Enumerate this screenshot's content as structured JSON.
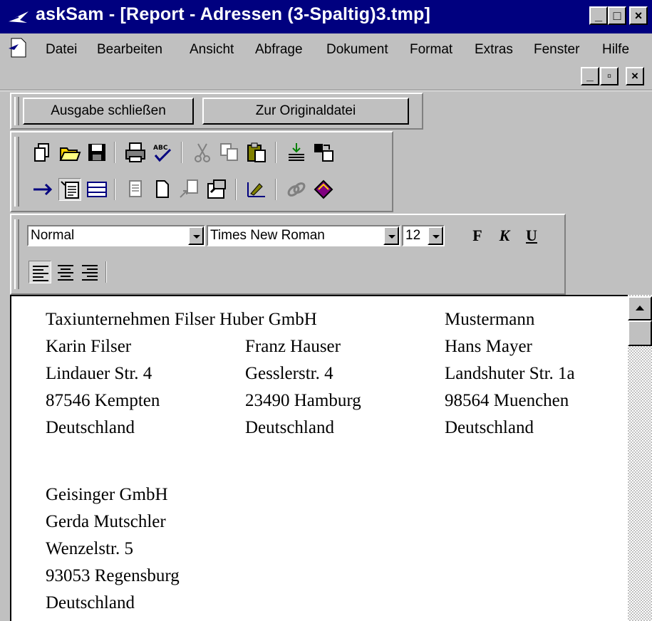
{
  "window": {
    "title": "askSam - [Report - Adressen (3-Spaltig)3.tmp]",
    "minimize_label": "_",
    "maximize_label": "□",
    "close_label": "×",
    "mdi_minimize_label": "_",
    "mdi_restore_label": "▫",
    "mdi_close_label": "×"
  },
  "menu": {
    "items": [
      "Datei",
      "Bearbeiten",
      "Ansicht",
      "Abfrage",
      "Dokument",
      "Format",
      "Extras",
      "Fenster",
      "Hilfe"
    ]
  },
  "report_toolbar": {
    "close_output": "Ausgabe schließen",
    "to_original": "Zur Originaldatei"
  },
  "format_toolbar": {
    "style_value": "Normal",
    "font_value": "Times New Roman",
    "size_value": "12",
    "bold_label": "F",
    "italic_label": "K",
    "underline_label": "U"
  },
  "document": {
    "columns": [
      [
        "Taxiunternehmen Filser Huber GmbH",
        "Karin Filser",
        "Lindauer Str. 4",
        "87546 Kempten",
        "Deutschland"
      ],
      [
        "Franz Hauser",
        "Gesslerstr. 4",
        "23490 Hamburg",
        "Deutschland"
      ],
      [
        "Mustermann",
        "Hans Mayer",
        "Landshuter Str. 1a",
        "98564 Muenchen",
        "Deutschland"
      ]
    ],
    "second_block": [
      "Geisinger GmbH",
      "Gerda Mutschler",
      "Wenzelstr. 5",
      "93053 Regensburg",
      "Deutschland"
    ]
  }
}
